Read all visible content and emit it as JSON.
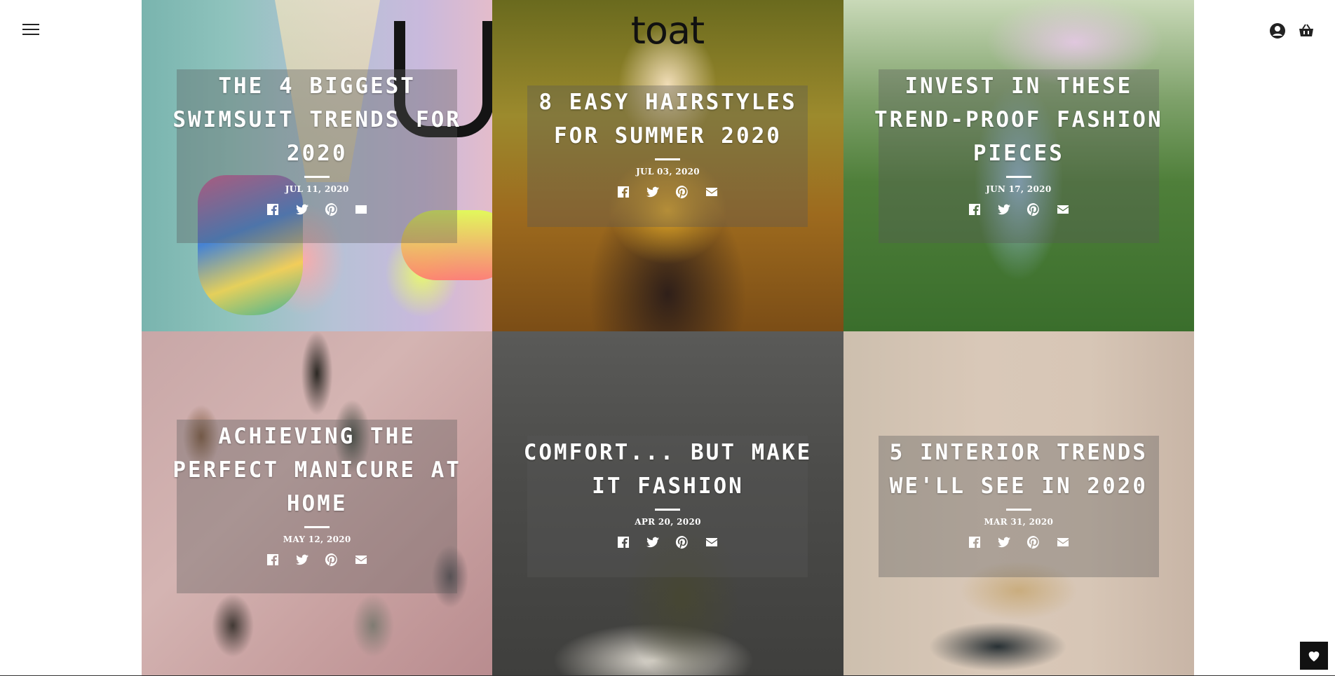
{
  "header": {
    "logo": "toat",
    "menu_icon": "hamburger-icon",
    "account_icon": "user-circle-icon",
    "cart_icon": "basket-icon"
  },
  "posts": [
    {
      "title": "THE 4 BIGGEST SWIMSUIT TRENDS FOR 2020",
      "date": "JUL 11, 2020"
    },
    {
      "title": "8 EASY HAIRSTYLES FOR SUMMER 2020",
      "date": "JUL 03, 2020"
    },
    {
      "title": "INVEST IN THESE TREND-PROOF FASHION PIECES",
      "date": "JUN 17, 2020"
    },
    {
      "title": "ACHIEVING THE PERFECT MANICURE AT HOME",
      "date": "MAY 12, 2020"
    },
    {
      "title": "COMFORT... BUT MAKE IT FASHION",
      "date": "APR 20, 2020"
    },
    {
      "title": "5 INTERIOR TRENDS WE'LL SEE IN 2020",
      "date": "MAR 31, 2020"
    }
  ],
  "share_icons": [
    "facebook-icon",
    "twitter-icon",
    "pinterest-icon",
    "email-icon"
  ],
  "wishlist_icon": "heart-icon",
  "colors": {
    "overlay": "#5a5a5a",
    "text": "#ffffff",
    "header_icon": "#222222"
  }
}
